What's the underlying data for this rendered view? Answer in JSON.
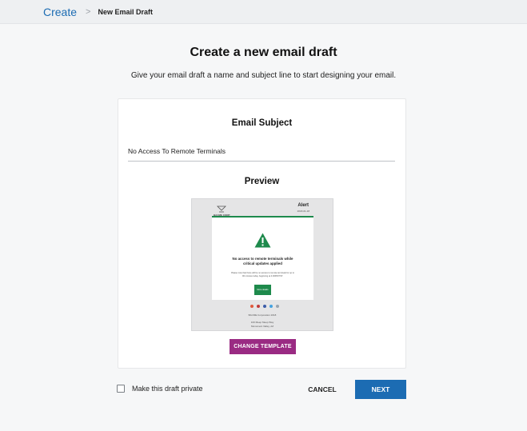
{
  "breadcrumb": {
    "root": "Create",
    "separator": ">",
    "current": "New Email Draft"
  },
  "page": {
    "title": "Create a new email draft",
    "subtitle": "Give your email draft a name and subject line to start designing your email."
  },
  "subject": {
    "heading": "Email Subject",
    "value": "No Access To Remote Terminals"
  },
  "preview": {
    "heading": "Preview",
    "logo_text": "BACME CORP",
    "alert": "Alert",
    "date": "2018-01-18",
    "headline_line1": "No access to remote terminals while",
    "headline_line2": "critical updates applied",
    "body_line1": "Please note that there will be no access to remote terminals for up to",
    "body_line2": "90 minutes today, beginning at 4:00PM PST.",
    "button": "More details",
    "footer_line1": "BACME Corporation 2018",
    "footer_line2": "100 Meep Meep Way",
    "footer_line3": "Monument Valley, AZ",
    "accent_color": "#1e8a4c",
    "social_icons": [
      "google-plus-icon",
      "pinterest-icon",
      "facebook-icon",
      "twitter-icon",
      "link-icon"
    ],
    "social_colors": [
      "#e05a3c",
      "#c23a3a",
      "#3b5ca8",
      "#44a2e0",
      "#9aa4ae"
    ]
  },
  "actions": {
    "change_template": "CHANGE TEMPLATE",
    "private_label": "Make this draft private",
    "cancel": "CANCEL",
    "next": "NEXT"
  },
  "colors": {
    "primary": "#1c6cb3",
    "template_button": "#9a2b83"
  }
}
